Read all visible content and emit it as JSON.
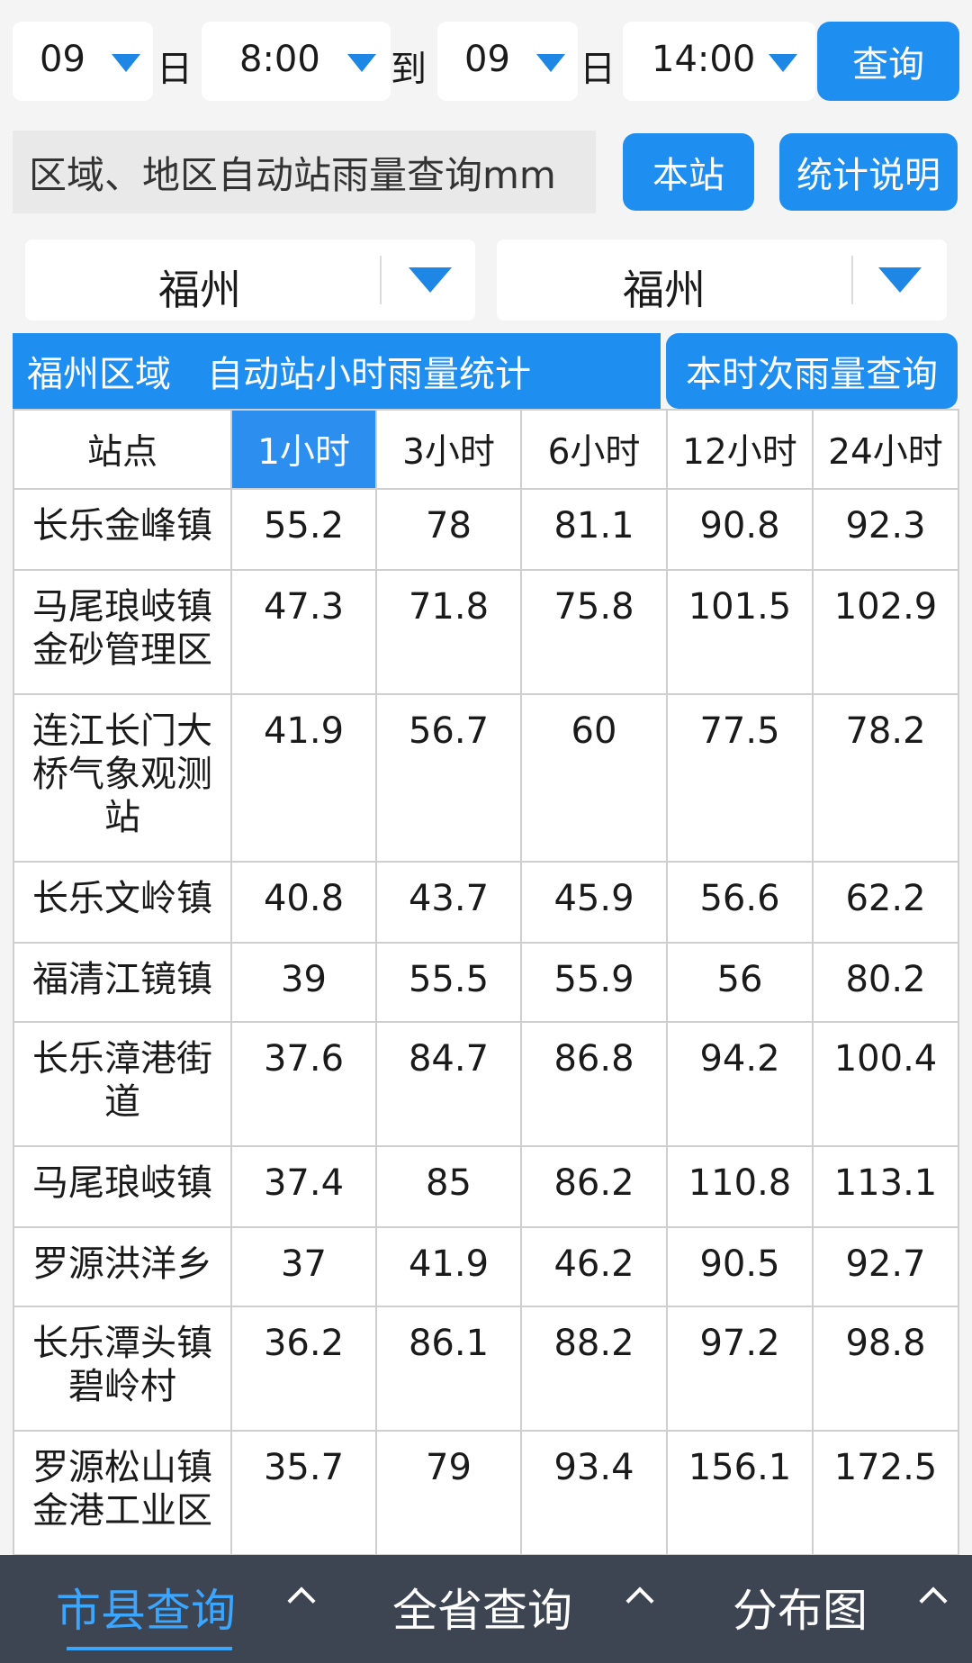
{
  "query": {
    "from_day": "09",
    "from_time": "8:00",
    "to_label": "到",
    "to_day": "09",
    "to_time": "14:00",
    "day_unit": "日",
    "search_label": "查询"
  },
  "region_query": {
    "title": "区域、地区自动站雨量查询mm",
    "this_station_label": "本站",
    "stats_explain_label": "统计说明"
  },
  "dropdowns": {
    "city": "福州",
    "district": "福州"
  },
  "section": {
    "title": "福州区域　自动站小时雨量统计",
    "current_query_label": "本时次雨量查询"
  },
  "table": {
    "headers": [
      "站点",
      "1小时",
      "3小时",
      "6小时",
      "12小时",
      "24小时"
    ],
    "rows": [
      {
        "station": "长乐金峰镇",
        "h1": "55.2",
        "h3": "78",
        "h6": "81.1",
        "h12": "90.8",
        "h24": "92.3"
      },
      {
        "station": "马尾琅岐镇金砂管理区",
        "h1": "47.3",
        "h3": "71.8",
        "h6": "75.8",
        "h12": "101.5",
        "h24": "102.9"
      },
      {
        "station": "连江长门大桥气象观测站",
        "h1": "41.9",
        "h3": "56.7",
        "h6": "60",
        "h12": "77.5",
        "h24": "78.2"
      },
      {
        "station": "长乐文岭镇",
        "h1": "40.8",
        "h3": "43.7",
        "h6": "45.9",
        "h12": "56.6",
        "h24": "62.2"
      },
      {
        "station": "福清江镜镇",
        "h1": "39",
        "h3": "55.5",
        "h6": "55.9",
        "h12": "56",
        "h24": "80.2"
      },
      {
        "station": "长乐漳港街道",
        "h1": "37.6",
        "h3": "84.7",
        "h6": "86.8",
        "h12": "94.2",
        "h24": "100.4"
      },
      {
        "station": "马尾琅岐镇",
        "h1": "37.4",
        "h3": "85",
        "h6": "86.2",
        "h12": "110.8",
        "h24": "113.1"
      },
      {
        "station": "罗源洪洋乡",
        "h1": "37",
        "h3": "41.9",
        "h6": "46.2",
        "h12": "90.5",
        "h24": "92.7"
      },
      {
        "station": "长乐潭头镇碧岭村",
        "h1": "36.2",
        "h3": "86.1",
        "h6": "88.2",
        "h12": "97.2",
        "h24": "98.8"
      },
      {
        "station": "罗源松山镇金港工业区",
        "h1": "35.7",
        "h3": "79",
        "h6": "93.4",
        "h12": "156.1",
        "h24": "172.5"
      }
    ]
  },
  "nav": {
    "city_county": "市县查询",
    "province": "全省查询",
    "distribution": "分布图"
  },
  "colors": {
    "accent": "#1e8ef0",
    "nav_bg": "#3d4452",
    "nav_active": "#3aa6ff"
  }
}
